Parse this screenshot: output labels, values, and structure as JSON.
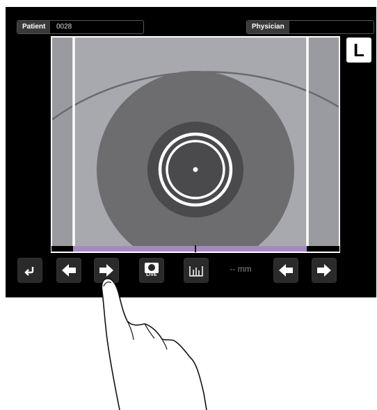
{
  "header": {
    "patient_label": "Patient",
    "patient_value": "0028",
    "physician_label": "Physician",
    "physician_value": ""
  },
  "eye_indicator": "L",
  "toolbar": {
    "buttons": [
      "back-icon",
      "arrow-left-icon",
      "arrow-right-icon",
      "live-camera-icon",
      "histogram-icon",
      "arrow-left-icon",
      "arrow-right-icon"
    ],
    "live_label": "LIVE",
    "measurement": "-- mm"
  },
  "colors": {
    "screen_bg": "#000000",
    "image_bg": "#9a9ba0",
    "iris": "#6d6d70",
    "pupil": "#4a4a4d",
    "range_bar": "#a58ac2"
  }
}
